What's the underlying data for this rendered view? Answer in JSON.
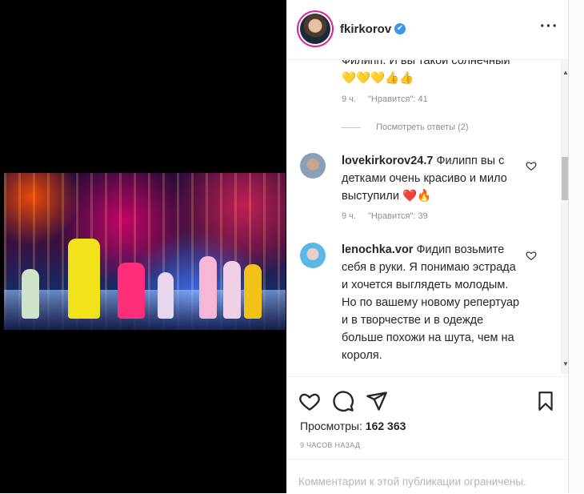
{
  "header": {
    "username": "fkirkorov",
    "verified_icon": "✔",
    "more_label": "···"
  },
  "comments": [
    {
      "username": "",
      "text": "Филипп. И вы такой солнечный 💛💛💛👍👍",
      "time": "9 ч.",
      "likes": "\"Нравится\": 41",
      "replies_label": "Посмотреть ответы (2)"
    },
    {
      "username": "lovekirkorov24.7",
      "text": "Филипп вы с детками очень красиво и мило выступили ❤️🔥",
      "time": "9 ч.",
      "likes": "\"Нравится\": 39"
    },
    {
      "username": "lenochka.vor",
      "text": "Фидип возьмите себя в руки. Я понимаю эстрада и хочется выглядеть молодым. Но по вашему новому репертуар и в творчестве и в одежде больше похожи на шута, чем на короля."
    }
  ],
  "actions": {
    "views_label": "Просмотры:",
    "views_count": "162 363",
    "timestamp": "9 ЧАСОВ НАЗАД"
  },
  "footer": {
    "comments_disabled": "Комментарии к этой публикации ограничены."
  },
  "colors": {
    "verified": "#3897f0",
    "link": "#262626",
    "muted": "#8e8e8e"
  }
}
